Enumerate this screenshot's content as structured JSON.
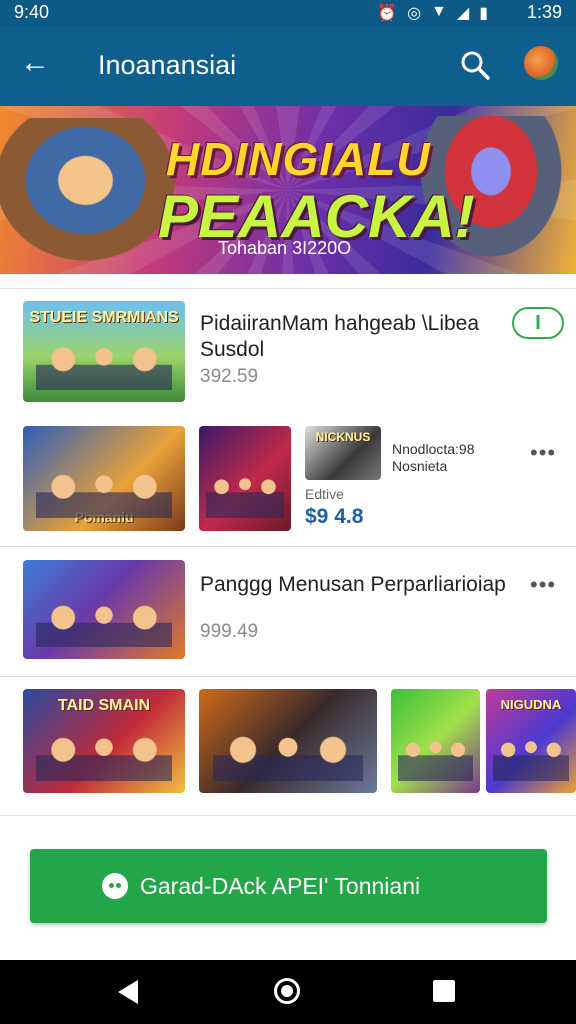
{
  "status_bar": {
    "time_left": "9:40",
    "time_right": "1:39",
    "icons": [
      "alarm-icon",
      "vibrate-icon",
      "wifi-icon",
      "signal-icon",
      "battery-icon",
      "battery-icon"
    ]
  },
  "app_bar": {
    "title": "Inoanansiai"
  },
  "banner": {
    "line1": "HDINGIALU",
    "line2": "PEAACKA!",
    "tagline": "Tohaban 3I220O"
  },
  "items": [
    {
      "title_line1": "PidaiiranMam hahgeab \\Libea",
      "title_line2": "Susdol",
      "price": "392.59",
      "action": "I",
      "thumb_caption": "STUEIE SMRMIANS"
    },
    {
      "thumb_caption_a": "Pomaniu",
      "side_title_line1": "Nnodlocta:98",
      "side_title_line2": "Nosnieta",
      "side_label": "Edtive",
      "side_price": "$9 4.8",
      "thumb_caption_c": "NICKNUS"
    },
    {
      "title": "Panggg Menusan Perparliarioiap",
      "price": "999.49"
    },
    {
      "thumb_caption_a": "TAID SMAIN",
      "thumb_caption_b": "NIGUDNA"
    }
  ],
  "cta": {
    "label": "Garad-DAck APEI' Tonniani"
  },
  "colors": {
    "primary": "#0f5f8e",
    "accent": "#22a647",
    "banner_text": "#ffd52e"
  }
}
